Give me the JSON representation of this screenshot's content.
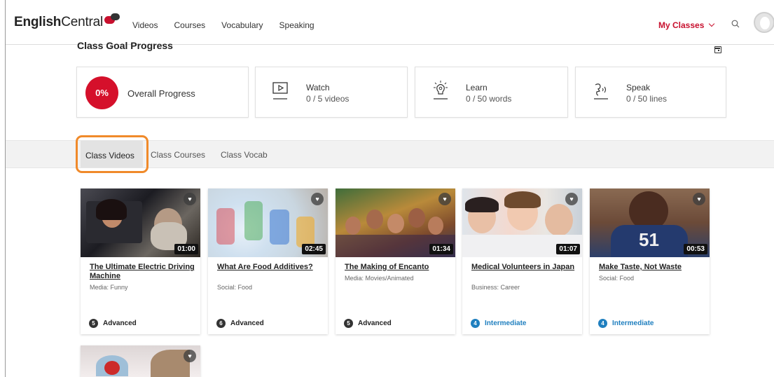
{
  "brand": {
    "bold": "English",
    "light": "Central",
    "accent": "#c8102e"
  },
  "nav": {
    "items": [
      "Videos",
      "Courses",
      "Vocabulary",
      "Speaking"
    ],
    "my_classes": "My Classes"
  },
  "goal": {
    "title": "Class Goal Progress",
    "overall": {
      "percent_label": "0%",
      "label": "Overall Progress"
    },
    "stats": [
      {
        "icon": "video-play-icon",
        "label": "Watch",
        "value": "0 / 5 videos"
      },
      {
        "icon": "lightbulb-icon",
        "label": "Learn",
        "value": "0 / 50 words"
      },
      {
        "icon": "speak-icon",
        "label": "Speak",
        "value": "0 / 50 lines"
      }
    ]
  },
  "tabs": [
    "Class Videos",
    "Class Courses",
    "Class Vocab"
  ],
  "videos": [
    {
      "title": "The Ultimate Electric Driving Machine",
      "category": "Media: Funny",
      "duration": "01:00",
      "level_num": "5",
      "level": "Advanced"
    },
    {
      "title": "What Are Food Additives?",
      "category": "Social: Food",
      "duration": "02:45",
      "level_num": "6",
      "level": "Advanced"
    },
    {
      "title": "The Making of Encanto",
      "category": "Media: Movies/Animated",
      "duration": "01:34",
      "level_num": "5",
      "level": "Advanced"
    },
    {
      "title": "Medical Volunteers in Japan",
      "category": "Business: Career",
      "duration": "01:07",
      "level_num": "4",
      "level": "Intermediate"
    },
    {
      "title": "Make Taste, Not Waste",
      "category": "Social: Food",
      "duration": "00:53",
      "level_num": "4",
      "level": "Intermediate"
    }
  ],
  "colors": {
    "progress_red": "#d5102b",
    "highlight_orange": "#f08a2a",
    "intermediate_blue": "#1f7fbf"
  }
}
